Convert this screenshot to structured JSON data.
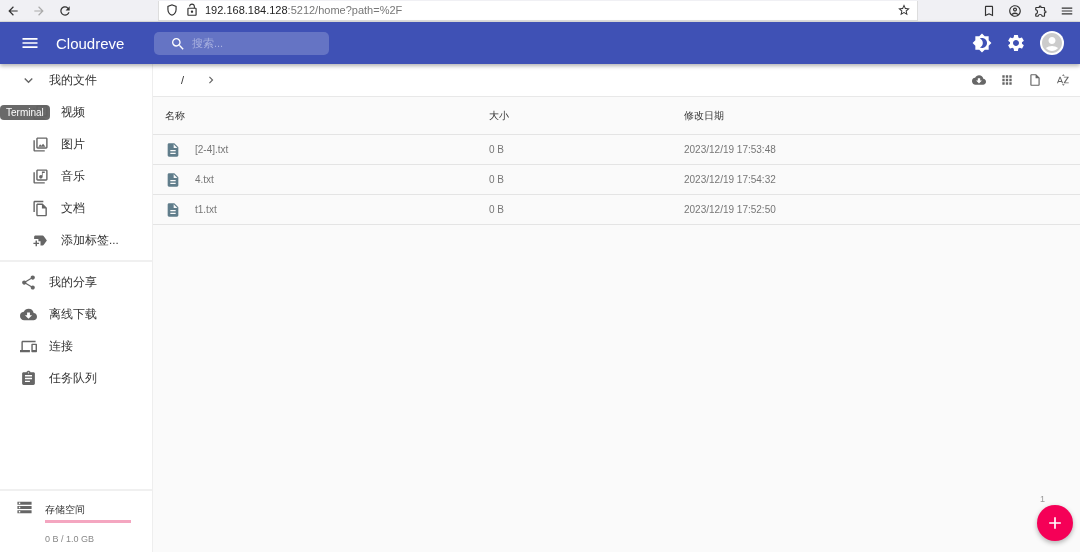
{
  "browser": {
    "url_host": "192.168.184.128",
    "url_rest": ":5212/home?path=%2F"
  },
  "header": {
    "title": "Cloudreve",
    "search": {
      "placeholder": "搜索..."
    }
  },
  "sidebar": {
    "items": [
      {
        "label": "我的文件",
        "kind": "folder",
        "expanded": true,
        "children": [
          {
            "label": "视频",
            "kind": "video"
          },
          {
            "label": "图片",
            "kind": "image"
          },
          {
            "label": "音乐",
            "kind": "music"
          },
          {
            "label": "文档",
            "kind": "doc"
          },
          {
            "label": "添加标签...",
            "kind": "tag"
          }
        ]
      },
      {
        "label": "我的分享",
        "kind": "share"
      },
      {
        "label": "离线下载",
        "kind": "download"
      },
      {
        "label": "连接",
        "kind": "devices"
      },
      {
        "label": "任务队列",
        "kind": "tasks"
      }
    ],
    "storage": {
      "label": "存储空间",
      "level": 0,
      "reading": "0 B / 1.0 GB"
    }
  },
  "tooltip": "Terminal",
  "breadcrumb": {
    "path": "/"
  },
  "table": {
    "columns": [
      "名称",
      "大小",
      "修改日期"
    ],
    "rows": [
      {
        "name": "[2-4].txt",
        "size": "0 B",
        "modified": "2023/12/19 17:53:48"
      },
      {
        "name": "4.txt",
        "size": "0 B",
        "modified": "2023/12/19 17:54:32"
      },
      {
        "name": "t1.txt",
        "size": "0 B",
        "modified": "2023/12/19 17:52:50"
      }
    ]
  },
  "fab_badge": "1"
}
